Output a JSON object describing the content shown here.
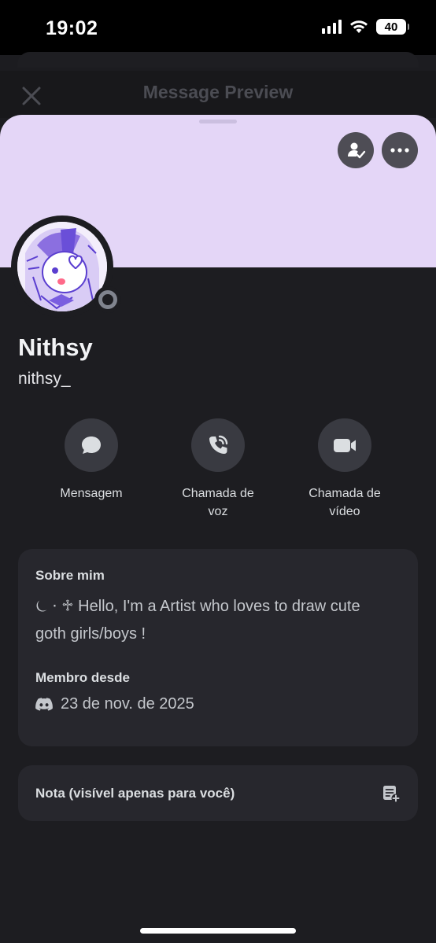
{
  "status_bar": {
    "time": "19:02",
    "battery": "40"
  },
  "background_modal": {
    "title": "Message Preview",
    "close_icon": "close-icon"
  },
  "profile": {
    "display_name": "Nithsy",
    "username": "nithsy_",
    "banner_color": "#e4d6f7",
    "status": "offline",
    "banner_buttons": [
      {
        "icon": "friend-check-icon"
      },
      {
        "icon": "more-icon"
      }
    ]
  },
  "actions": [
    {
      "icon": "chat-bubble-icon",
      "label_line1": "Mensagem",
      "label_line2": ""
    },
    {
      "icon": "phone-call-icon",
      "label_line1": "Chamada de",
      "label_line2": "voz"
    },
    {
      "icon": "video-camera-icon",
      "label_line1": "Chamada de",
      "label_line2": "vídeo"
    }
  ],
  "about": {
    "heading": "Sobre mim",
    "text_line1": "⏾ ⋅ ♱ Hello, I'm a Artist who loves to draw cute",
    "text_line2": "goth girls/boys !",
    "member_since_heading": "Membro desde",
    "member_since_date": "23 de nov. de 2025",
    "member_since_icon": "discord-logo-icon"
  },
  "note": {
    "label": "Nota (visível apenas para você)",
    "icon": "add-note-icon"
  },
  "colors": {
    "sheet_bg": "#1d1d21",
    "card_bg": "#27272d",
    "button_bg": "#393a41",
    "text_primary": "#f2f3f5",
    "text_secondary": "#c4c7cc"
  }
}
